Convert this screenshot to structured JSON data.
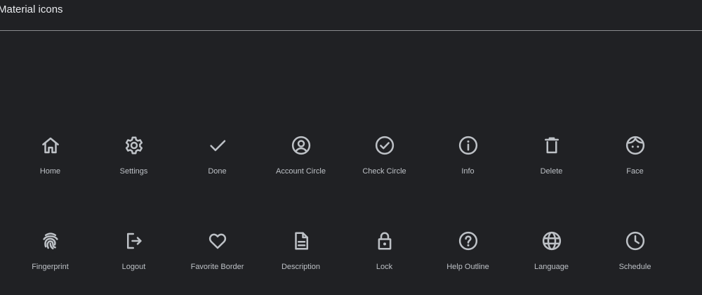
{
  "header": {
    "title": "Material icons"
  },
  "icons": [
    {
      "label": "Home",
      "icon": "home-icon"
    },
    {
      "label": "Settings",
      "icon": "settings-icon"
    },
    {
      "label": "Done",
      "icon": "done-icon"
    },
    {
      "label": "Account Circle",
      "icon": "account-circle-icon"
    },
    {
      "label": "Check Circle",
      "icon": "check-circle-icon"
    },
    {
      "label": "Info",
      "icon": "info-icon"
    },
    {
      "label": "Delete",
      "icon": "delete-icon"
    },
    {
      "label": "Face",
      "icon": "face-icon"
    },
    {
      "label": "Fingerprint",
      "icon": "fingerprint-icon"
    },
    {
      "label": "Logout",
      "icon": "logout-icon"
    },
    {
      "label": "Favorite Border",
      "icon": "favorite-border-icon"
    },
    {
      "label": "Description",
      "icon": "description-icon"
    },
    {
      "label": "Lock",
      "icon": "lock-icon"
    },
    {
      "label": "Help Outline",
      "icon": "help-outline-icon"
    },
    {
      "label": "Language",
      "icon": "language-icon"
    },
    {
      "label": "Schedule",
      "icon": "schedule-icon"
    }
  ],
  "colors": {
    "background": "#202124",
    "icon": "#bdc1c6",
    "label": "#bdc1c6",
    "title": "#e8eaed",
    "divider": "#8a8c8f"
  }
}
